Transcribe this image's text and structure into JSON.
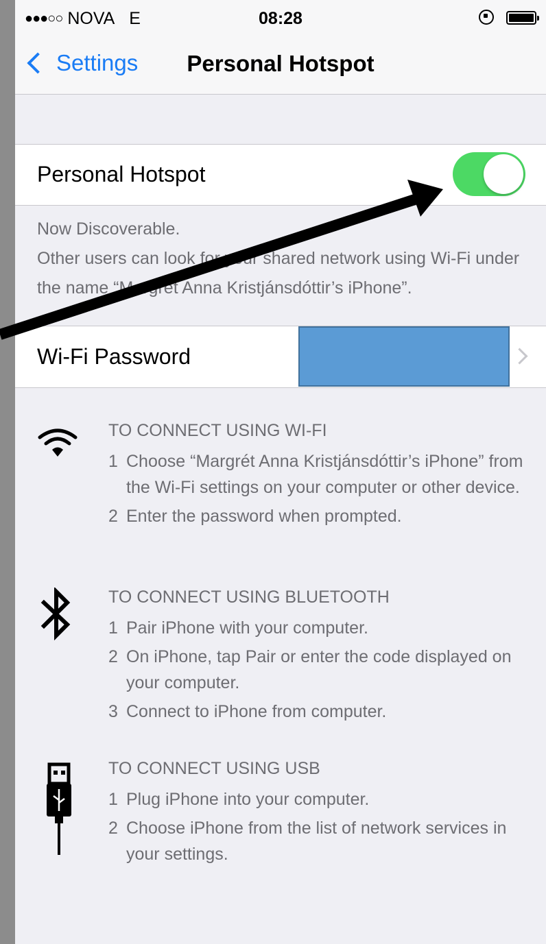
{
  "status_bar": {
    "carrier": "NOVA",
    "network": "E",
    "time": "08:28"
  },
  "nav": {
    "back_label": "Settings",
    "title": "Personal Hotspot"
  },
  "hotspot": {
    "label": "Personal Hotspot",
    "enabled": true,
    "footer_line1": "Now Discoverable.",
    "footer_line2": "Other users can look for your shared network using Wi-Fi under the name “Margrét Anna Kristjánsdóttir’s iPhone”."
  },
  "wifi_password": {
    "label": "Wi-Fi Password"
  },
  "instructions": {
    "wifi": {
      "icon": "wifi-icon",
      "heading": "TO CONNECT USING WI-FI",
      "steps": [
        {
          "num": "1",
          "text": "Choose “Margrét Anna Kristjánsdóttir’s iPhone” from the Wi-Fi settings on your computer or other device."
        },
        {
          "num": "2",
          "text": "Enter the password when prompted."
        }
      ]
    },
    "bluetooth": {
      "icon": "bluetooth-icon",
      "heading": "TO CONNECT USING BLUETOOTH",
      "steps": [
        {
          "num": "1",
          "text": "Pair iPhone with your computer."
        },
        {
          "num": "2",
          "text": "On iPhone, tap Pair or enter the code displayed on your computer."
        },
        {
          "num": "3",
          "text": "Connect to iPhone from computer."
        }
      ]
    },
    "usb": {
      "icon": "usb-icon",
      "heading": "TO CONNECT USING USB",
      "steps": [
        {
          "num": "1",
          "text": "Plug iPhone into your computer."
        },
        {
          "num": "2",
          "text": "Choose iPhone from the list of network services in your settings."
        }
      ]
    }
  },
  "colors": {
    "accent": "#1a7cf5",
    "toggle_on": "#4cd964",
    "redaction": "#5b9bd5",
    "annotation_arrow": "#000000"
  }
}
